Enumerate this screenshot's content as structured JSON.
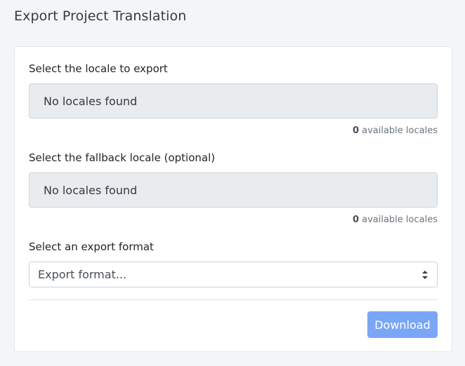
{
  "page": {
    "title": "Export Project Translation"
  },
  "locale_field": {
    "label": "Select the locale to export",
    "value": "No locales found",
    "count": "0",
    "count_suffix": " available locales"
  },
  "fallback_field": {
    "label": "Select the fallback locale (optional)",
    "value": "No locales found",
    "count": "0",
    "count_suffix": " available locales"
  },
  "format_field": {
    "label": "Select an export format",
    "selected": "Export format..."
  },
  "actions": {
    "download_label": "Download"
  },
  "colors": {
    "primary_disabled": "#7aa7f5",
    "readonly_bg": "#e9ecef"
  }
}
